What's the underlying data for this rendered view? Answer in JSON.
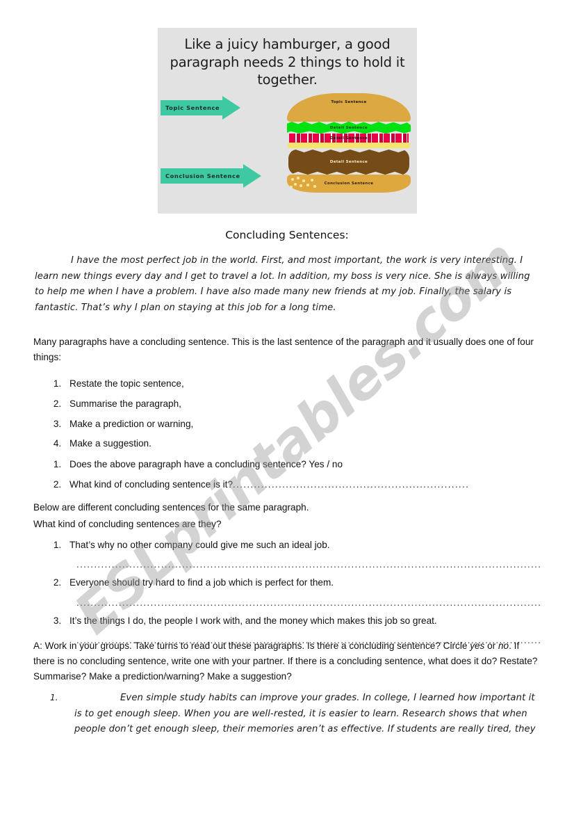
{
  "figure": {
    "heading": "Like a juicy hamburger, a good paragraph needs 2 things to hold it together.",
    "arrow_top_label": "Topic Sentence",
    "arrow_bottom_label": "Conclusion Sentence",
    "layers": [
      {
        "name": "top-bun",
        "label": "Topic Sentence",
        "color": "#dba842"
      },
      {
        "name": "lettuce",
        "label": "Detail Sentence",
        "color": "#00e211"
      },
      {
        "name": "tomato",
        "label": "Detail Sentence",
        "color": "#ea0047"
      },
      {
        "name": "cheese",
        "label": "",
        "color": "#f7e46a"
      },
      {
        "name": "patty",
        "label": "Detail Sentence",
        "color": "#754c17"
      },
      {
        "name": "bottom-bun",
        "label": "Conclusion Sentence",
        "color": "#dfa83f"
      }
    ],
    "background_color": "#e2e2e2",
    "arrow_color": "#3ec9a2"
  },
  "document": {
    "title": "Concluding Sentences:",
    "sample_paragraph": "I have the most perfect job in the world. First, and most important, the work is very interesting. I learn new things every day and I get to travel a lot. In addition, my boss is very nice. She is always willing to help me when I have a problem. I have also made many new friends at my job. Finally, the salary is fantastic. That’s why I plan on staying at this job for a long time.",
    "intro_text": "Many paragraphs have a concluding sentence. This is the last sentence of the paragraph and it usually does one of four things:",
    "four_things": [
      "Restate the topic sentence,",
      "Summarise the paragraph,",
      "Make a prediction or warning,",
      "Make a suggestion."
    ],
    "questions": [
      "Does the above paragraph have a concluding sentence?  Yes /  no",
      "What kind of concluding sentence is it?"
    ],
    "below_line1": "Below are different concluding sentences for the same paragraph.",
    "below_line2": "What kind of concluding sentences are they?",
    "sentence_list": [
      "That’s why no other company could give me such an ideal job.",
      "Everyone should try hard to find a job which is perfect for them.",
      "It’s the things I do, the people I work with, and the money which makes this job so great."
    ],
    "section_a": {
      "part1": "A: Work in your groups. Take turns to read out these paragraphs. Is there a concluding sentence? Circle ",
      "em1": "yes",
      "part2": " or ",
      "em2": "no",
      "part3": ". If there is no concluding sentence, write one with your partner. If there is a concluding sentence, what does it do? Restate? Summarise? Make a prediction/warning? Make a suggestion?"
    },
    "final_item_number": "1.",
    "final_paragraph": "Even simple study habits can improve your grades. In college, I learned how important it is to get enough sleep. When you are well-rested, it is easier to learn. Research shows that when people don’t get enough sleep, their memories aren’t as effective. If students are really tired, they"
  },
  "watermark": {
    "text": "ESLprintables.com",
    "color": "#969696"
  }
}
